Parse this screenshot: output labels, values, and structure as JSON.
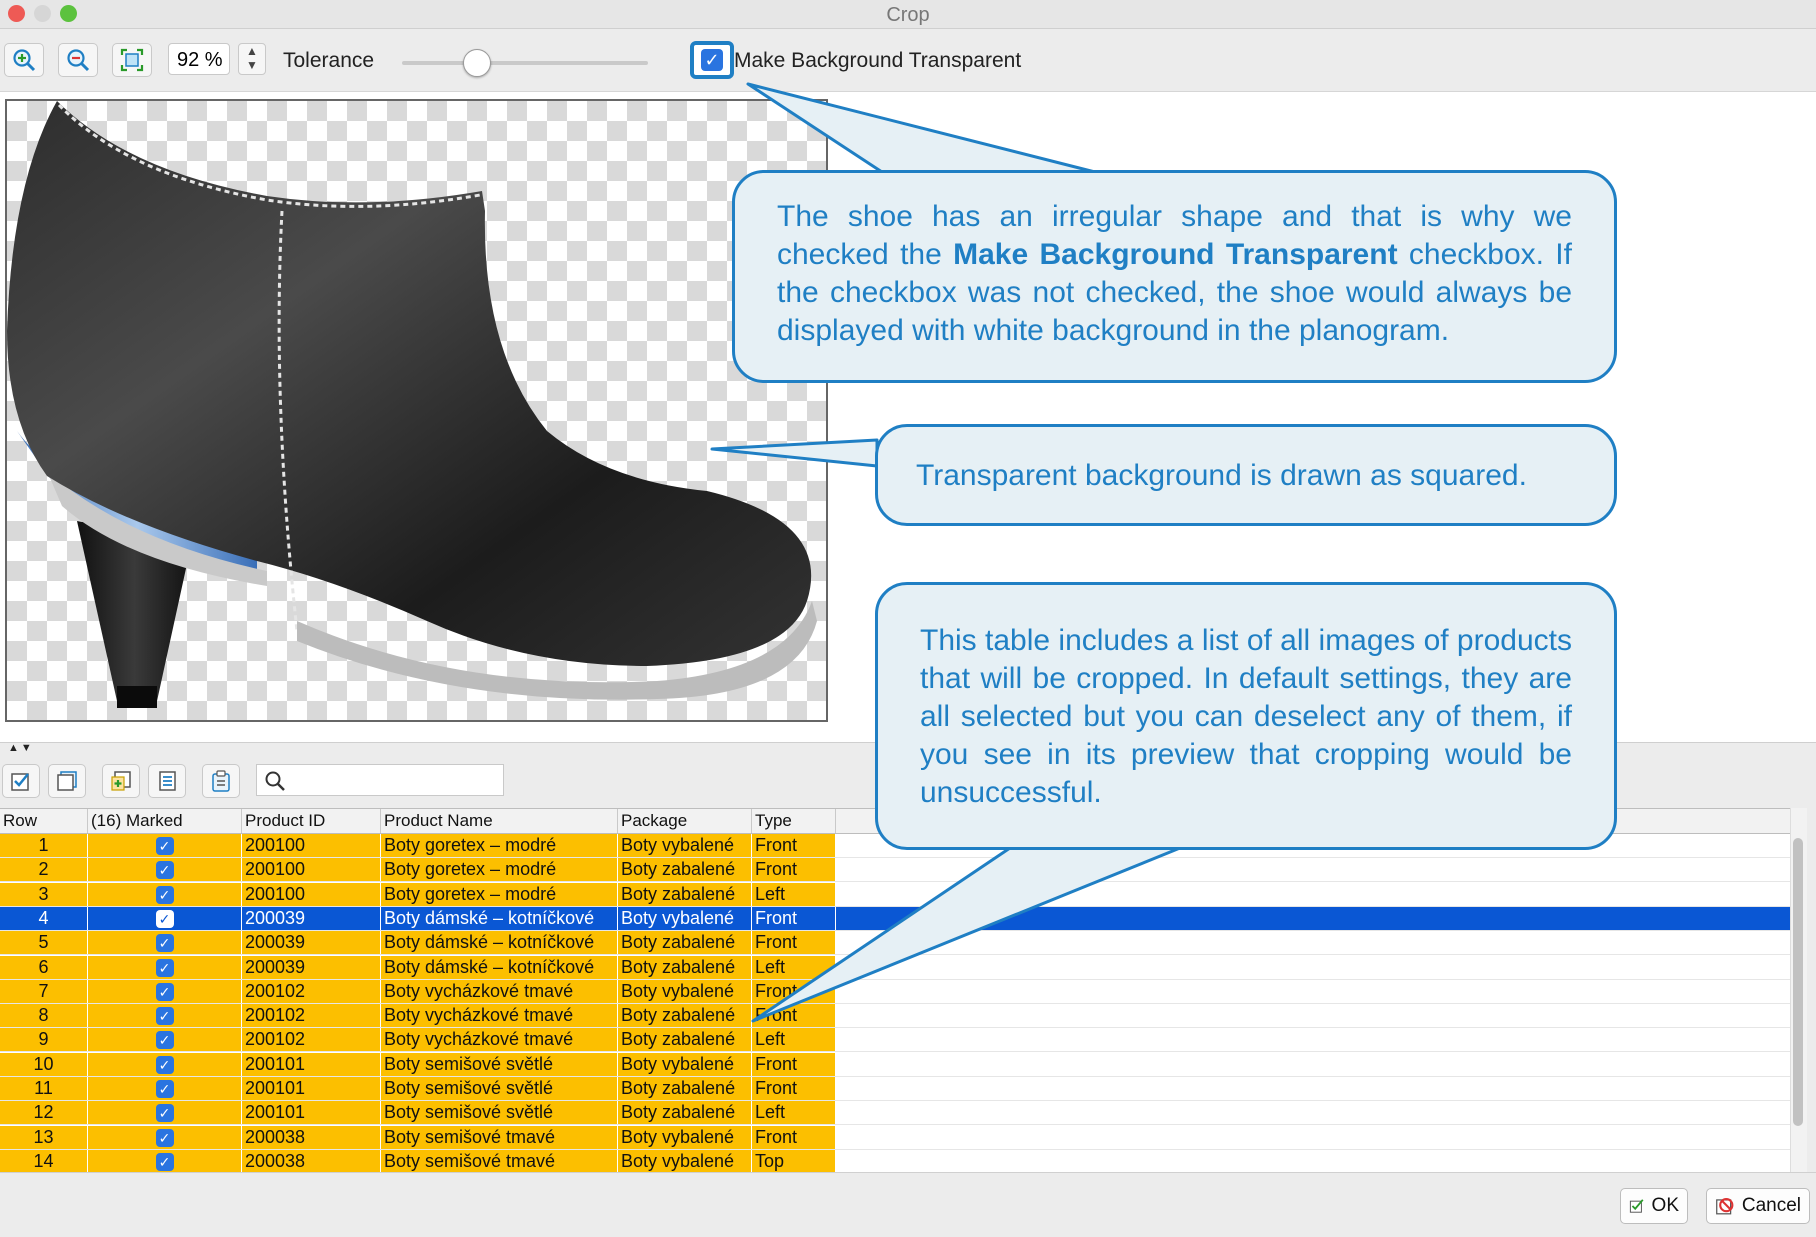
{
  "window": {
    "title": "Crop"
  },
  "toolbar": {
    "zoom_value": "92 %",
    "tolerance_label": "Tolerance",
    "tolerance_level": 0.3,
    "transparent_checkbox_label": "Make Background Transparent",
    "transparent_checked": true
  },
  "table": {
    "columns": [
      "Row",
      "(16) Marked",
      "Product ID",
      "Product Name",
      "Package",
      "Type"
    ],
    "rows": [
      {
        "row": "1",
        "marked": true,
        "pid": "200100",
        "name": "Boty goretex – modré",
        "pkg": "Boty vybalené",
        "type": "Front"
      },
      {
        "row": "2",
        "marked": true,
        "pid": "200100",
        "name": "Boty goretex – modré",
        "pkg": "Boty zabalené",
        "type": "Front"
      },
      {
        "row": "3",
        "marked": true,
        "pid": "200100",
        "name": "Boty goretex – modré",
        "pkg": "Boty zabalené",
        "type": "Left"
      },
      {
        "row": "4",
        "marked": true,
        "pid": "200039",
        "name": "Boty dámské – kotníčkové",
        "pkg": "Boty vybalené",
        "type": "Front"
      },
      {
        "row": "5",
        "marked": true,
        "pid": "200039",
        "name": "Boty dámské – kotníčkové",
        "pkg": "Boty zabalené",
        "type": "Front"
      },
      {
        "row": "6",
        "marked": true,
        "pid": "200039",
        "name": "Boty dámské – kotníčkové",
        "pkg": "Boty zabalené",
        "type": "Left"
      },
      {
        "row": "7",
        "marked": true,
        "pid": "200102",
        "name": "Boty vycházkové tmavé",
        "pkg": "Boty vybalené",
        "type": "Front"
      },
      {
        "row": "8",
        "marked": true,
        "pid": "200102",
        "name": "Boty vycházkové tmavé",
        "pkg": "Boty zabalené",
        "type": "Front"
      },
      {
        "row": "9",
        "marked": true,
        "pid": "200102",
        "name": "Boty vycházkové tmavé",
        "pkg": "Boty zabalené",
        "type": "Left"
      },
      {
        "row": "10",
        "marked": true,
        "pid": "200101",
        "name": "Boty semišové světlé",
        "pkg": "Boty vybalené",
        "type": "Front"
      },
      {
        "row": "11",
        "marked": true,
        "pid": "200101",
        "name": "Boty semišové světlé",
        "pkg": "Boty zabalené",
        "type": "Front"
      },
      {
        "row": "12",
        "marked": true,
        "pid": "200101",
        "name": "Boty semišové světlé",
        "pkg": "Boty zabalené",
        "type": "Left"
      },
      {
        "row": "13",
        "marked": true,
        "pid": "200038",
        "name": "Boty semišové tmavé",
        "pkg": "Boty vybalené",
        "type": "Front"
      },
      {
        "row": "14",
        "marked": true,
        "pid": "200038",
        "name": "Boty semišové tmavé",
        "pkg": "Boty vybalené",
        "type": "Top"
      }
    ],
    "selected_row": 4
  },
  "buttons": {
    "ok": "OK",
    "cancel": "Cancel"
  },
  "callouts": {
    "c1_part1": "The shoe has an irregular shape and that is why we checked the ",
    "c1_bold": "Make Background Transparent",
    "c1_part2": " checkbox. If the checkbox was not checked, the shoe would always be displayed with white background in the planogram.",
    "c2": "Transparent background is drawn as squared.",
    "c3": "This table includes a list of all images of products that will be cropped. In default settings, they are all selected but you can deselect any of them, if you see in its preview that cropping would be unsuccessful."
  },
  "icons": {
    "toolbar": [
      "zoom-in-icon",
      "zoom-out-icon",
      "fit-to-window-icon"
    ],
    "table_toolbar": [
      "mark-all-icon",
      "unmark-all-icon",
      "add-icon",
      "list-icon",
      "paste-icon",
      "search-icon"
    ]
  },
  "colors": {
    "accent": "#1f7fc4",
    "row_highlight": "#fcbf00",
    "row_selected": "#0a57d4",
    "checkbox": "#2a74e0"
  }
}
